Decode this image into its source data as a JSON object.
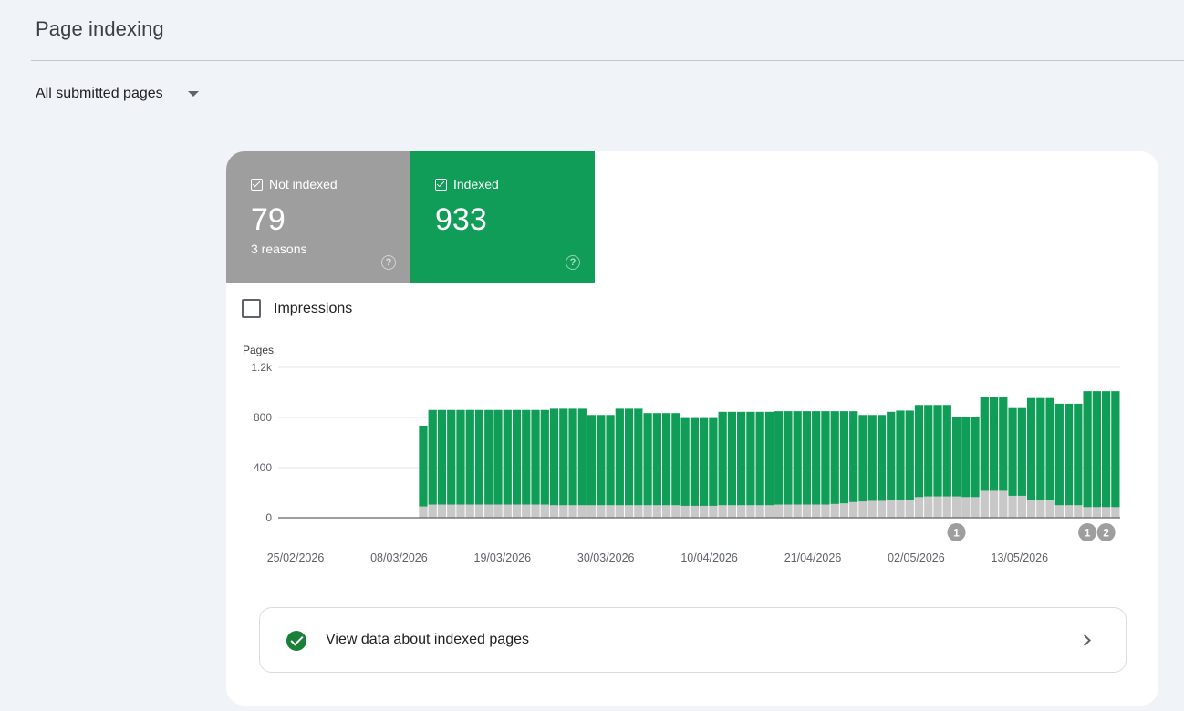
{
  "page": {
    "title": "Page indexing"
  },
  "filter": {
    "label": "All submitted pages"
  },
  "tiles": {
    "not_indexed": {
      "label": "Not indexed",
      "value": "79",
      "sub": "3 reasons",
      "help": "?"
    },
    "indexed": {
      "label": "Indexed",
      "value": "933",
      "help": "?"
    }
  },
  "impressions": {
    "label": "Impressions",
    "checked": false
  },
  "bottom": {
    "label": "View data about indexed pages"
  },
  "colors": {
    "indexed": "#109d58",
    "not_indexed": "#c8c8c8",
    "grey_tile": "#9e9e9e"
  },
  "chart_data": {
    "type": "bar",
    "stacked": true,
    "ylabel": "Pages",
    "ylim": [
      0,
      1200
    ],
    "yticks": [
      0,
      400,
      800,
      1200
    ],
    "ytick_labels": [
      "0",
      "400",
      "800",
      "1.2k"
    ],
    "x_tick_labels": [
      "25/02/2026",
      "08/03/2026",
      "19/03/2026",
      "30/03/2026",
      "10/04/2026",
      "21/04/2026",
      "02/05/2026",
      "13/05/2026"
    ],
    "series": [
      {
        "key": "not_indexed",
        "values": [
          0,
          0,
          0,
          0,
          0,
          0,
          0,
          0,
          0,
          0,
          0,
          0,
          0,
          0,
          0,
          90,
          105,
          105,
          105,
          105,
          105,
          105,
          105,
          105,
          105,
          105,
          105,
          105,
          105,
          100,
          100,
          100,
          100,
          100,
          100,
          100,
          100,
          100,
          100,
          100,
          100,
          100,
          100,
          95,
          95,
          95,
          95,
          100,
          100,
          100,
          100,
          100,
          100,
          105,
          105,
          105,
          105,
          105,
          105,
          110,
          115,
          125,
          130,
          135,
          135,
          140,
          145,
          145,
          165,
          170,
          170,
          170,
          170,
          165,
          165,
          215,
          215,
          215,
          175,
          175,
          140,
          140,
          140,
          100,
          100,
          100,
          85,
          85,
          85,
          85
        ]
      },
      {
        "key": "indexed",
        "values": [
          0,
          0,
          0,
          0,
          0,
          0,
          0,
          0,
          0,
          0,
          0,
          0,
          0,
          0,
          0,
          645,
          755,
          755,
          755,
          755,
          755,
          755,
          755,
          755,
          755,
          755,
          755,
          755,
          755,
          770,
          770,
          770,
          770,
          720,
          720,
          720,
          770,
          770,
          770,
          735,
          735,
          735,
          735,
          700,
          700,
          700,
          700,
          745,
          745,
          745,
          745,
          745,
          745,
          745,
          745,
          745,
          745,
          745,
          745,
          740,
          735,
          725,
          690,
          685,
          685,
          705,
          710,
          710,
          735,
          730,
          730,
          730,
          635,
          640,
          640,
          745,
          745,
          745,
          700,
          700,
          815,
          815,
          815,
          810,
          810,
          810,
          925,
          925,
          925,
          925
        ]
      }
    ],
    "annotations": [
      {
        "bar_index": 72,
        "label": "1"
      },
      {
        "bar_index": 86,
        "label": "1"
      },
      {
        "bar_index": 88,
        "label": "2"
      }
    ]
  }
}
